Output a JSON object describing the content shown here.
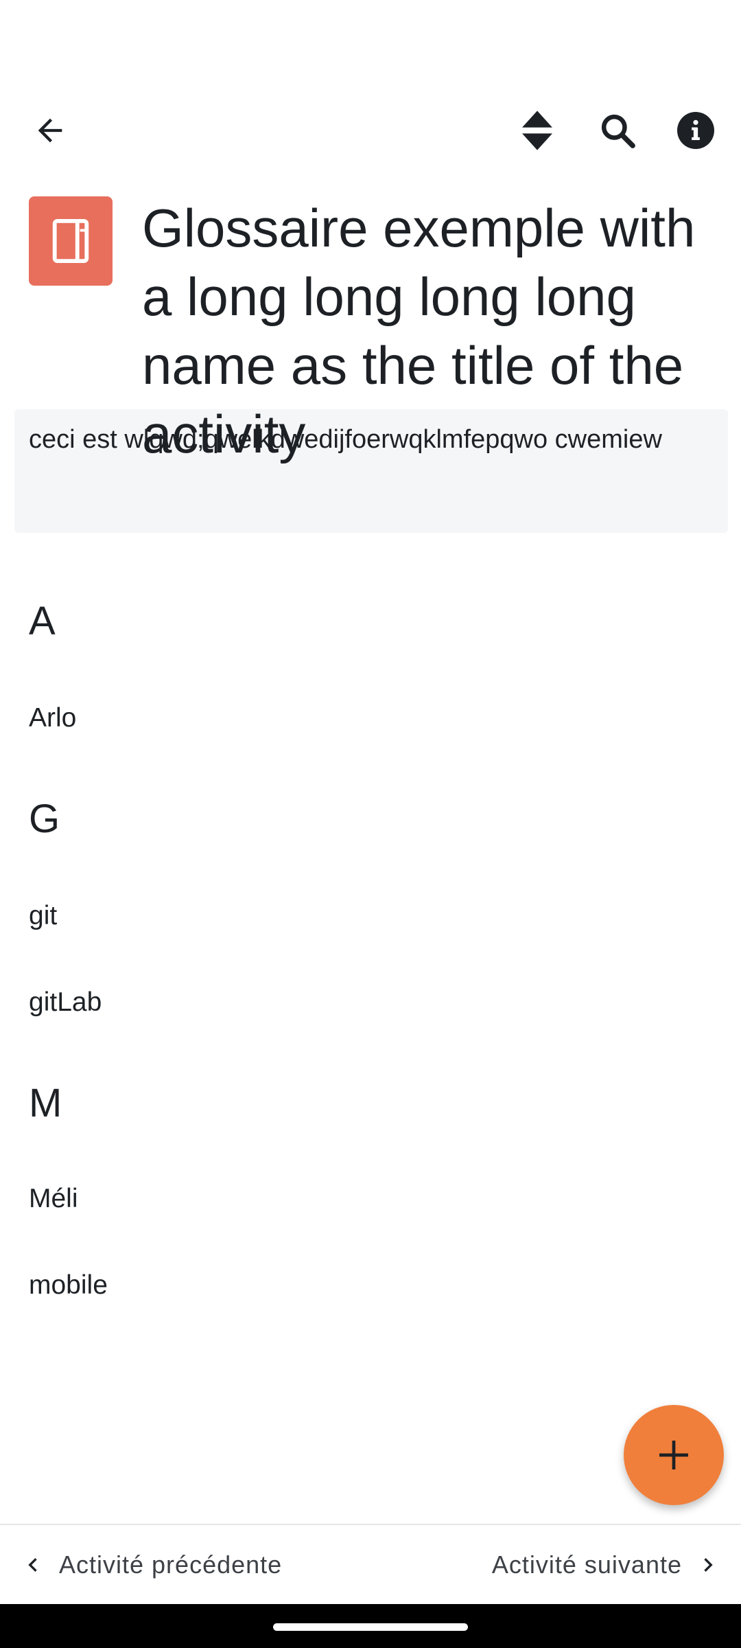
{
  "activity": {
    "title": "Glossaire exemple with a long long long long name as the title of the activity",
    "description": "ceci est wlqwd;qwelkdwedijfoerwqklmfepqwo cwemiew"
  },
  "icons": {
    "back": "arrow-left-icon",
    "sort": "sort-icon",
    "search": "search-icon",
    "info": "info-icon",
    "activity": "glossary-book-icon",
    "add": "plus-icon",
    "prev": "chevron-left-icon",
    "next": "chevron-right-icon"
  },
  "colors": {
    "activity_icon_bg": "#e76f5c",
    "fab_bg": "#f07f3b",
    "description_bg": "#f5f6f8"
  },
  "sections": [
    {
      "letter": "A",
      "entries": [
        "Arlo"
      ]
    },
    {
      "letter": "G",
      "entries": [
        "git",
        "gitLab"
      ]
    },
    {
      "letter": "M",
      "entries": [
        "Méli",
        "mobile"
      ]
    }
  ],
  "bottom_nav": {
    "previous_label": "Activité précédente",
    "next_label": "Activité suivante"
  }
}
